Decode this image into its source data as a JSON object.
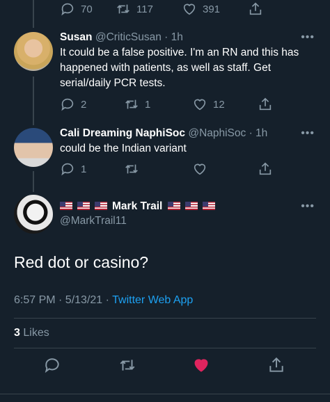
{
  "top_tweet": {
    "replies": "70",
    "retweets": "117",
    "likes": "391"
  },
  "replies": [
    {
      "display_name": "Susan",
      "handle": "@CriticSusan",
      "time": "· 1h",
      "text": "It could be a false positive. I'm an RN and this has happened with patients, as well as staff. Get serial/daily PCR tests.",
      "reply_count": "2",
      "retweet_count": "1",
      "like_count": "12"
    },
    {
      "display_name": "Cali Dreaming NaphiSoc",
      "handle": "@NaphiSoc",
      "time": "· 1h",
      "text": "could be the Indian variant",
      "reply_count": "1",
      "retweet_count": "",
      "like_count": ""
    }
  ],
  "main_tweet": {
    "display_name": "Mark Trail",
    "handle": "@MarkTrail11",
    "text": "Red dot or casino?",
    "timestamp": "6:57 PM · 5/13/21 · ",
    "source": "Twitter Web App",
    "likes_count": "3",
    "likes_label": "Likes"
  },
  "more_glyph": "•••",
  "colors": {
    "background": "#15202b",
    "secondary_text": "#8899a6",
    "link": "#1da1f2",
    "like_active": "#e0245e",
    "divider": "#38444d"
  },
  "icons": [
    "reply-icon",
    "retweet-icon",
    "like-icon",
    "share-icon",
    "more-icon",
    "us-flag-icon"
  ]
}
